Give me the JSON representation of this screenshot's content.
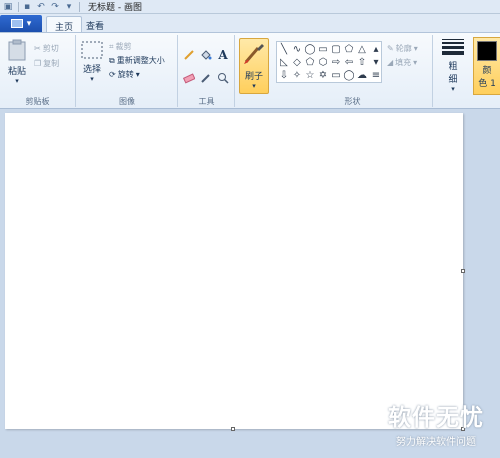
{
  "window": {
    "title": "无标题 - 画图"
  },
  "tabs": [
    {
      "label": "主页"
    },
    {
      "label": "查看"
    }
  ],
  "clipboard": {
    "paste": "粘贴",
    "cut": "剪切",
    "copy": "复制",
    "label": "剪贴板"
  },
  "image": {
    "select": "选择",
    "crop": "裁剪",
    "resize": "重新调整大小",
    "rotate": "旋转",
    "label": "图像"
  },
  "tools": {
    "label": "工具"
  },
  "brushes": {
    "label": "刷子"
  },
  "shapes": {
    "outline": "轮廓",
    "fill": "填充",
    "label": "形状"
  },
  "size": {
    "label_1": "粗",
    "label_2": "细"
  },
  "color1": {
    "label_1": "颜",
    "label_2": "色 1",
    "value": "#000000"
  },
  "watermark": {
    "main": "软件无忧",
    "sub": "努力解决软件问题"
  }
}
